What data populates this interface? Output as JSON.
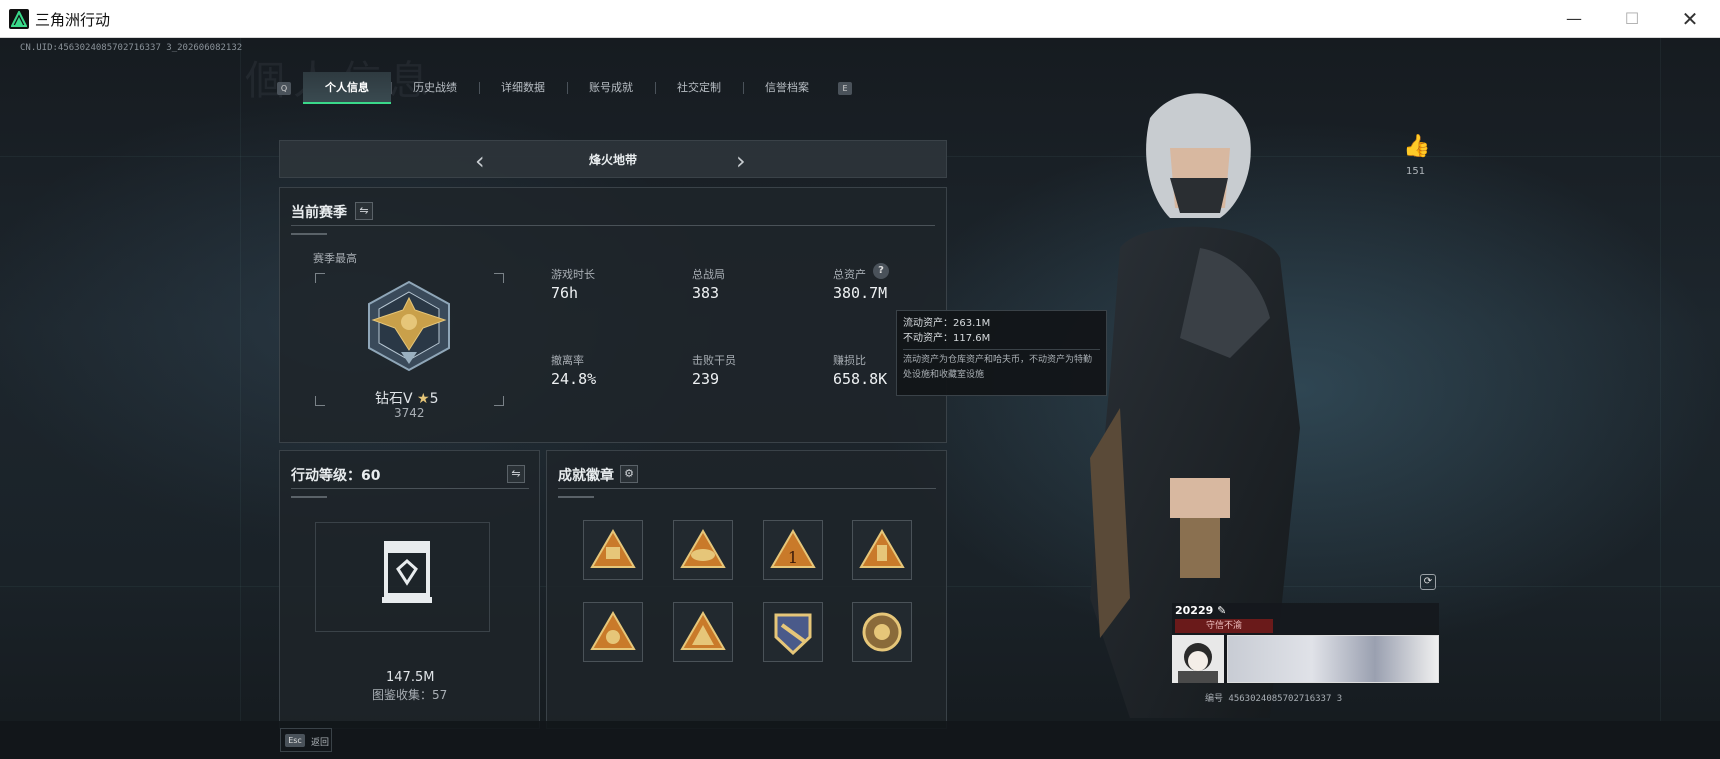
{
  "window": {
    "title": "三角洲行动",
    "minimize_icon": "minimize-icon",
    "maximize_icon": "maximize-icon",
    "close_icon": "close-icon"
  },
  "uid_line": "CN.UID:4563024085702716337 3_202606082132",
  "tabs": {
    "left_key": "Q",
    "right_key": "E",
    "items": [
      {
        "label": "个人信息",
        "active": true
      },
      {
        "label": "历史战绩",
        "active": false
      },
      {
        "label": "详细数据",
        "active": false
      },
      {
        "label": "账号成就",
        "active": false
      },
      {
        "label": "社交定制",
        "active": false
      },
      {
        "label": "信誉档案",
        "active": false
      }
    ]
  },
  "mode": {
    "title": "烽火地带",
    "prev_icon": "chevron-left-icon",
    "next_icon": "chevron-right-icon"
  },
  "season": {
    "title": "当前赛季",
    "swap_icon": "swap-icon",
    "highest_label": "赛季最高",
    "rank_name": "钻石V",
    "rank_stars": "5",
    "rank_score": "3742",
    "stats": [
      {
        "label": "游戏时长",
        "value": "76h"
      },
      {
        "label": "总战局",
        "value": "383"
      },
      {
        "label": "总资产",
        "value": "380.7M"
      },
      {
        "label": "撤离率",
        "value": "24.8%"
      },
      {
        "label": "击败干员",
        "value": "239"
      },
      {
        "label": "赚损比",
        "value": "658.8K"
      }
    ],
    "help_icon": "question-icon"
  },
  "tooltip": {
    "liquid": "流动资产：263.1M",
    "fixed": "不动资产：117.6M",
    "note": "流动资产为仓库资产和哈夫币，不动资产为特勤处设施和收藏室设施"
  },
  "level": {
    "title": "行动等级：",
    "value": "60",
    "swap_icon": "swap-icon",
    "asset_value": "147.5M",
    "collection_label": "图鉴收集：",
    "collection_value": "57"
  },
  "badges": {
    "title": "成就徽章",
    "settings_icon": "gear-icon",
    "items": [
      "badge-1",
      "badge-2",
      "badge-3",
      "badge-4",
      "badge-5",
      "badge-6",
      "badge-7",
      "badge-8"
    ]
  },
  "profile": {
    "likes": "151",
    "like_icon": "thumbs-up-icon",
    "refresh_icon": "refresh-icon",
    "player_name": "20229",
    "edit_icon": "pencil-icon",
    "tag": "守信不渝",
    "id_line": "编号 4563024085702716337 3"
  },
  "footer": {
    "esc_key": "Esc",
    "esc_label": "返回"
  },
  "colors": {
    "accent": "#3ad98a",
    "gold": "#c9a04a",
    "tag_red": "#6a1a1a"
  }
}
